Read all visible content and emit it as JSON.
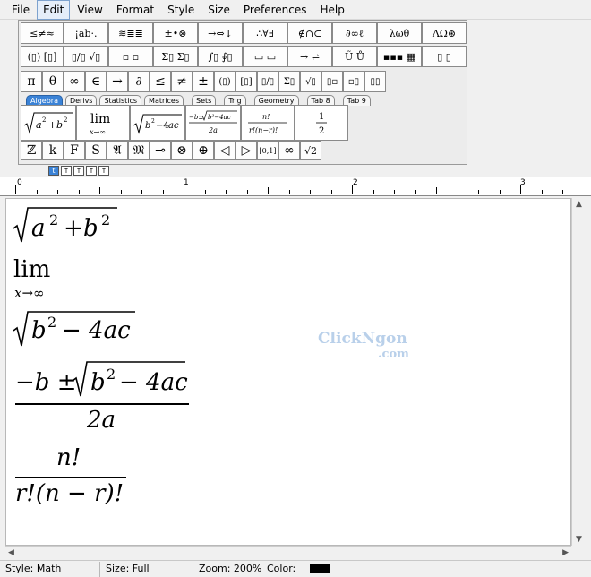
{
  "menu": [
    "File",
    "Edit",
    "View",
    "Format",
    "Style",
    "Size",
    "Preferences",
    "Help"
  ],
  "palette": {
    "row1": [
      "≤≠≈",
      "¡ab·.",
      "≋≣≣",
      "±•⊗",
      "→⇔↓",
      "∴∀∃",
      "∉∩⊂",
      "∂∞ℓ",
      "λωθ",
      "ΛΩ⊛"
    ],
    "row2": [
      "(▯) [▯]",
      "▯/▯ √▯",
      "▫ ▫",
      "Σ▯ Σ▯",
      "∫▯ ∮▯",
      "▭ ▭",
      "→ ⇌",
      "Ũ Ů",
      "▪▪▪ ▦",
      "▯ ▯"
    ],
    "row3": [
      "π",
      "θ",
      "∞",
      "∈",
      "→",
      "∂",
      "≤",
      "≠",
      "±",
      "(▯)",
      "[▯]",
      "▯/▯",
      "Σ▯",
      "√▯",
      "▯▫",
      "▫▯",
      "▯▯"
    ],
    "tabs": [
      "Algebra",
      "Derivs",
      "Statistics",
      "Matrices",
      "Sets",
      "Trig",
      "Geometry",
      "Tab 8",
      "Tab 9"
    ],
    "active_tab": "Algebra",
    "small_row": [
      "ℤ",
      "k",
      "F",
      "S",
      "𝔄",
      "𝔐",
      "⊸",
      "⊗",
      "⊕",
      "◁",
      "▷",
      "[0,1]",
      "∞",
      "√2"
    ],
    "mini_buttons": [
      "t",
      "↑",
      "↑",
      "↑",
      "↑"
    ]
  },
  "ruler": {
    "labels": [
      "0",
      "1",
      "2",
      "3"
    ]
  },
  "document": {
    "eq1": {
      "a": "a",
      "two": "2",
      "plus": "+",
      "b": "b"
    },
    "eq2": {
      "lim": "lim",
      "sub": "x→∞"
    },
    "eq3": {
      "b": "b",
      "two": "2",
      "rest": "− 4ac"
    },
    "eq4": {
      "num_pre": "−b ±",
      "b": "b",
      "two": "2",
      "rest": "− 4ac",
      "den": "2a"
    },
    "eq5": {
      "num": "n!",
      "den": "r!(n − r)!"
    }
  },
  "watermark": {
    "line1": "ClickNgon",
    "line2": ".com"
  },
  "status": {
    "style": "Style: Math",
    "size": "Size: Full",
    "zoom": "Zoom: 200%",
    "color": "Color:"
  }
}
